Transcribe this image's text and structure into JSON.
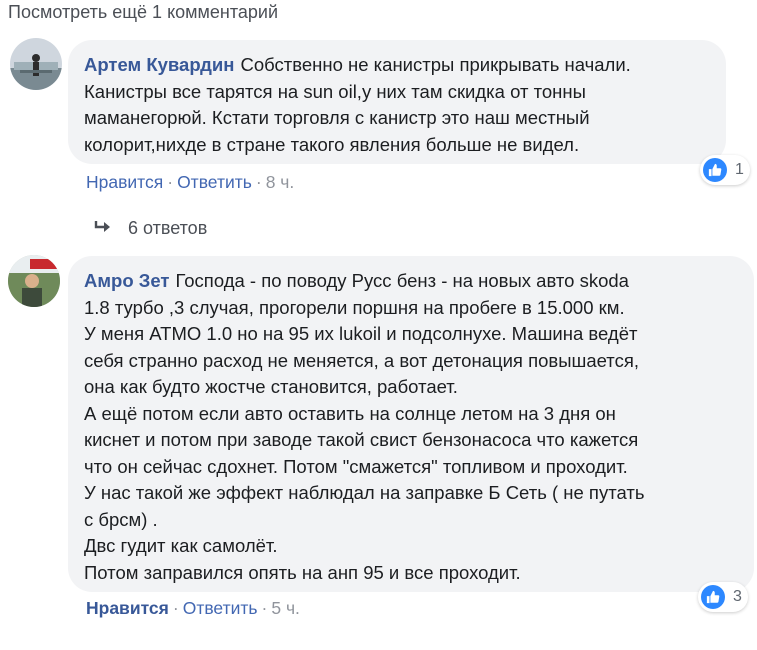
{
  "view_more": "Посмотреть ещё 1 комментарий",
  "comments": [
    {
      "author": "Артем Кувардин",
      "text_lines": [
        "Собственно не канистры прикрывать начали.",
        "Канистры все тарятся на sun oil,у них там скидка от тонны",
        "маманегорюй. Кстати торговля с канистр это наш местный",
        "колорит,нихде в стране такого явления больше не видел."
      ],
      "like_label": "Нравится",
      "reply_label": "Ответить",
      "time": "8 ч.",
      "reaction_count": "1"
    },
    {
      "author": "Амро Зет",
      "text_lines": [
        "Господа - по поводу Русс бенз - на новых авто skoda",
        "1.8 турбо ,3 случая, прогорели поршня на пробеге в 15.000 км.",
        "У меня АТМО 1.0 но на 95 их lukoil и подсолнухе. Машина ведёт",
        "себя странно расход не меняется, а вот детонация повышается,",
        "она как будто жостче становится, работает.",
        "А ещё потом если авто оставить на солнце летом на 3 дня он",
        "киснет и потом при заводе такой свист бензонасоса что кажется",
        "что он сейчас сдохнет. Потом \"смажется\" топливом и проходит.",
        "У нас такой же эффект наблюдал на заправке Б Сеть ( не путать",
        "с брсм) .",
        "Двс гудит как самолёт.",
        "Потом заправился опять на анп 95 и все проходит."
      ],
      "like_label": "Нравится",
      "reply_label": "Ответить",
      "time": "5 ч.",
      "reaction_count": "3"
    }
  ],
  "replies_label": "6 ответов",
  "colors": {
    "bubble": "#f2f3f5",
    "author": "#385898",
    "link": "#4267b2",
    "like_blue": "#2d88ff"
  }
}
